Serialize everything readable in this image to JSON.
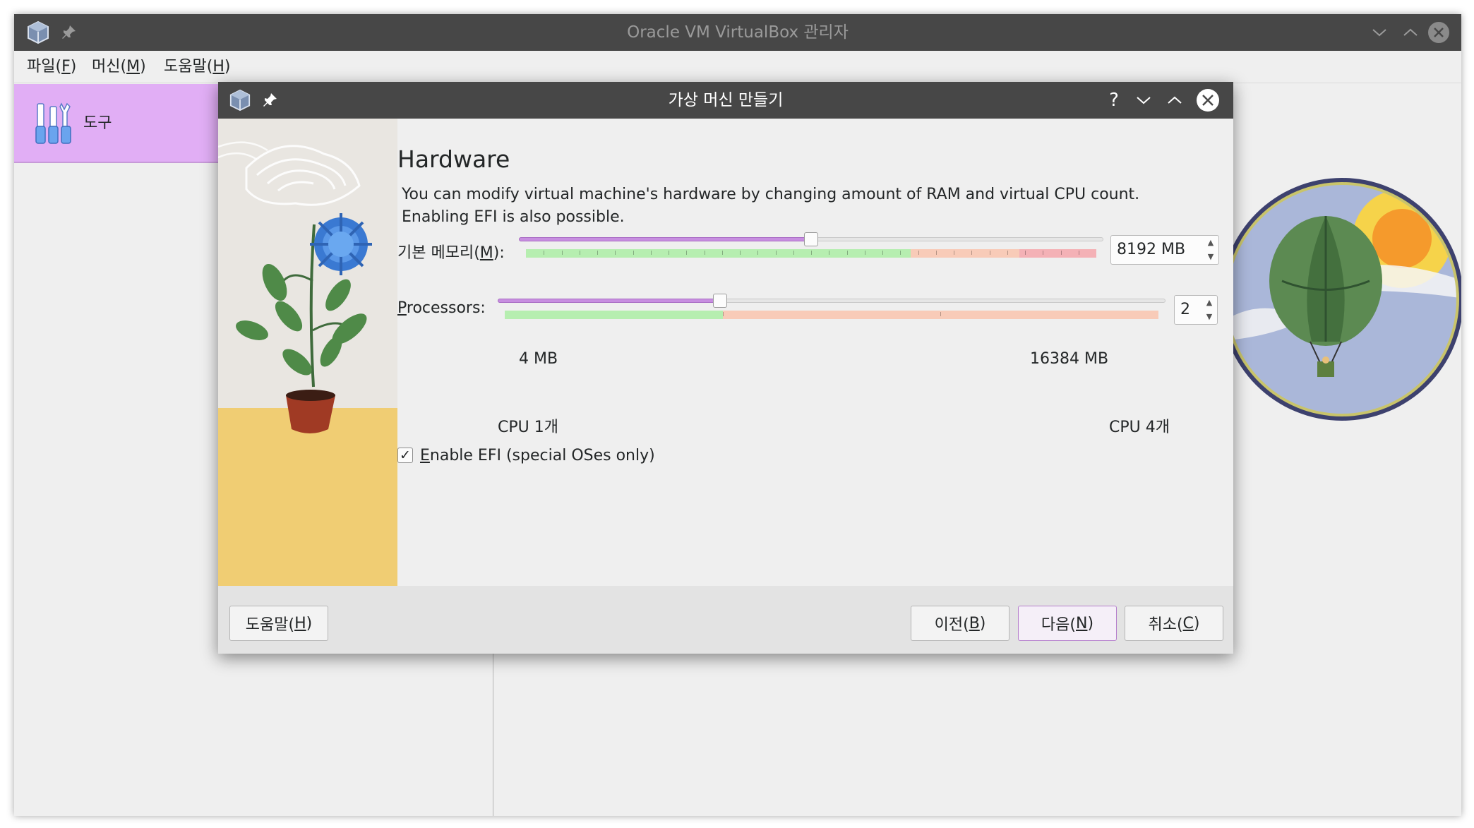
{
  "main_window": {
    "title": "Oracle VM VirtualBox 관리자",
    "menu": [
      {
        "label": "파일(",
        "mnemonic": "F",
        "close": ")"
      },
      {
        "label": "머신(",
        "mnemonic": "M",
        "close": ")"
      },
      {
        "label": "도움말(",
        "mnemonic": "H",
        "close": ")"
      }
    ],
    "tools_label": "도구"
  },
  "dialog": {
    "title": "가상 머신 만들기",
    "help_glyph": "?",
    "page_title": "Hardware",
    "description_line1": "You can modify virtual machine's hardware by changing amount of RAM and virtual CPU count.",
    "description_line2": "Enabling EFI is also possible.",
    "memory": {
      "label": "기본 메모리(",
      "mnemonic": "M",
      "label_end": "):",
      "value": "8192 MB",
      "min_label": "4 MB",
      "max_label": "16384 MB",
      "min": 4,
      "max": 16384,
      "current": 8192
    },
    "processors": {
      "label_mnemonic": "P",
      "label": "rocessors:",
      "value": "2",
      "min_label": "CPU 1개",
      "max_label": "CPU 4개",
      "min": 1,
      "max": 4,
      "current": 2
    },
    "efi": {
      "checked": true,
      "check_glyph": "✓",
      "label_mnemonic": "E",
      "label": "nable EFI (special OSes only)"
    },
    "buttons": {
      "help": {
        "label": "도움말(",
        "mnemonic": "H",
        "close": ")"
      },
      "back": {
        "label": "이전(",
        "mnemonic": "B",
        "close": ")"
      },
      "next": {
        "label": "다음(",
        "mnemonic": "N",
        "close": ")"
      },
      "cancel": {
        "label": "취소(",
        "mnemonic": "C",
        "close": ")"
      }
    }
  },
  "colors": {
    "titlebar": "#474747",
    "accent": "#c78ee0",
    "tools_bg": "#e1aef5",
    "scale_green": "#b6eeb0",
    "scale_orange": "#f8cbb8",
    "scale_red": "#f4b1b6"
  }
}
